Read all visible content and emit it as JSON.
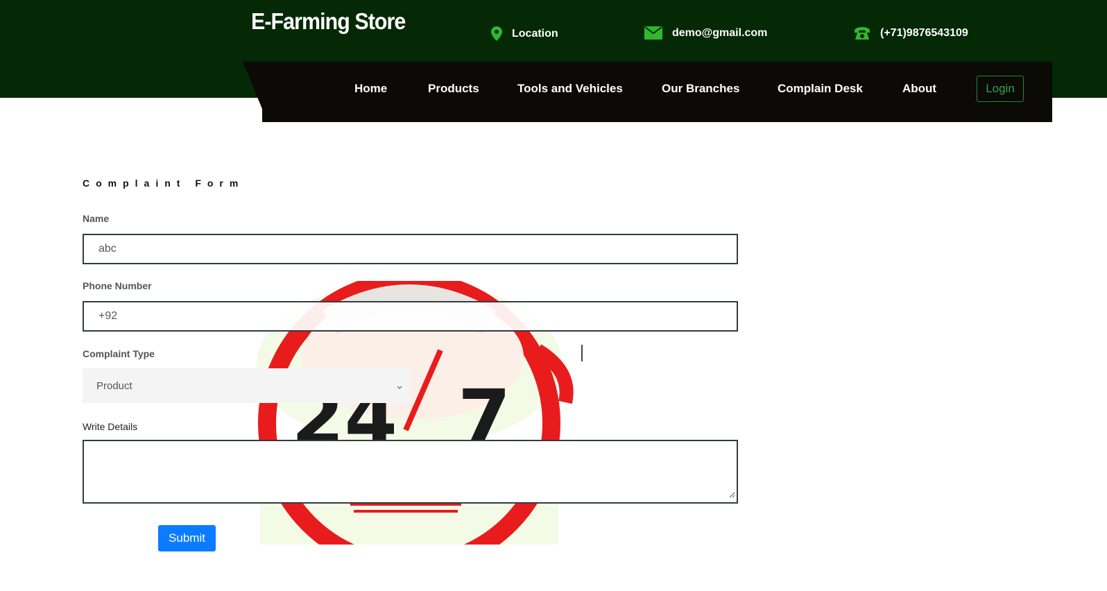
{
  "header": {
    "brand": "E-Farming Store",
    "location_label": "Location",
    "email": "demo@gmail.com",
    "phone": "(+71)9876543109"
  },
  "nav": {
    "items": [
      {
        "label": "Home"
      },
      {
        "label": "Products"
      },
      {
        "label": "Tools and Vehicles"
      },
      {
        "label": "Our Branches"
      },
      {
        "label": "Complain Desk"
      },
      {
        "label": "About"
      }
    ],
    "login_label": "Login"
  },
  "form": {
    "title": "Complaint Form",
    "name_label": "Name",
    "name_value": "abc",
    "phone_label": "Phone Number",
    "phone_value": "+92",
    "type_label": "Complaint Type",
    "type_selected": "Product",
    "details_label": "Write Details",
    "details_value": "",
    "submit_label": "Submit"
  },
  "colors": {
    "header_bg": "#052805",
    "nav_bg": "#0b0a06",
    "icon_green": "#2fb82f",
    "login_border": "#1f8a34",
    "submit_bg": "#0b7cff"
  },
  "icons": {
    "location": "map-pin-icon",
    "email": "envelope-icon",
    "phone": "telephone-icon",
    "select": "chevron-down-icon",
    "resize": "resize-grip-icon"
  }
}
